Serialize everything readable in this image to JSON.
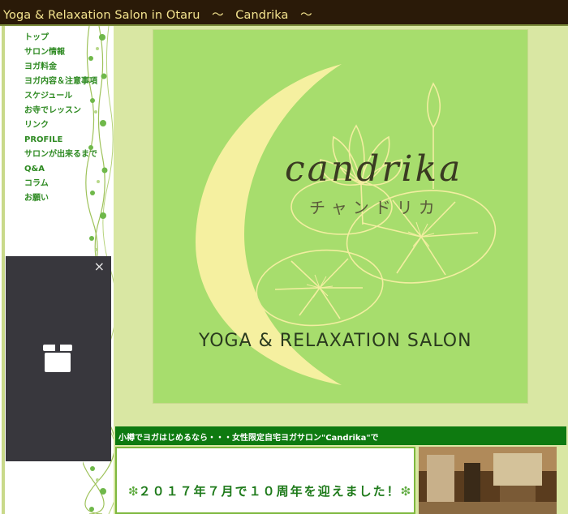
{
  "header": {
    "title": "Yoga & Relaxation Salon in Otaru　～　Candrika　～"
  },
  "sidebar": {
    "items": [
      {
        "label": "トップ"
      },
      {
        "label": "サロン情報"
      },
      {
        "label": "ヨガ料金"
      },
      {
        "label": "ヨガ内容＆注意事項"
      },
      {
        "label": "スケジュール"
      },
      {
        "label": "お寺でレッスン"
      },
      {
        "label": "リンク"
      },
      {
        "label": "PROFILE"
      },
      {
        "label": "サロンが出来るまで"
      },
      {
        "label": "Q&A"
      },
      {
        "label": "コラム"
      },
      {
        "label": "お願い"
      }
    ]
  },
  "popup": {
    "close_symbol": "×",
    "icon": "gift-icon"
  },
  "logo": {
    "brand": "candrika",
    "katakana": "チャンドリカ",
    "tagline": "YOGA & RELAXATION SALON"
  },
  "caption": {
    "text": "小樽でヨガはじめるなら・・・女性限定自宅ヨガサロン\"Candrika\"で"
  },
  "content": {
    "flower_left": "❇",
    "headline": "２０１７年７月で１０周年を迎えました！",
    "flower_right": "❇"
  },
  "colors": {
    "header_bg": "#2a1a08",
    "header_text": "#f4e48f",
    "nav_text": "#2e8a22",
    "logo_bg": "#a7dd6d",
    "moon": "#f5f0a0",
    "caption_bg": "#0e7a10"
  }
}
